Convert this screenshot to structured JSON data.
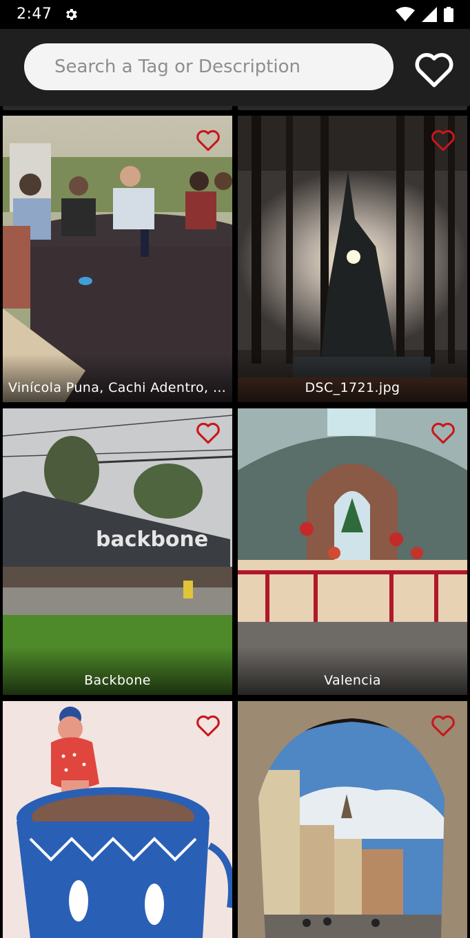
{
  "status_bar": {
    "time": "2:47"
  },
  "search": {
    "placeholder": "Search a Tag or Description",
    "value": ""
  },
  "accent_color": "#c8161d",
  "tiles": [
    {
      "caption": "Vinícola Puna, Cachi Adentro, …",
      "favorite_icon": "heart-outline-icon"
    },
    {
      "caption": "DSC_1721.jpg",
      "favorite_icon": "heart-outline-icon"
    },
    {
      "caption": "Backbone",
      "favorite_icon": "heart-outline-icon"
    },
    {
      "caption": "Valencia",
      "favorite_icon": "heart-outline-icon"
    },
    {
      "caption": "",
      "favorite_icon": "heart-outline-icon"
    },
    {
      "caption": "",
      "favorite_icon": "heart-outline-icon"
    }
  ]
}
